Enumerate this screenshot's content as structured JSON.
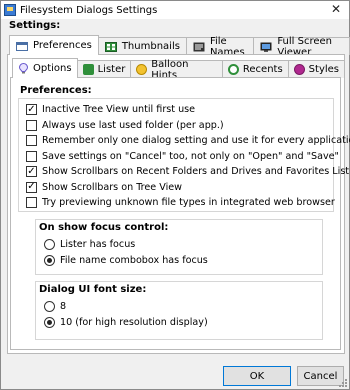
{
  "window": {
    "title": "Filesystem Dialogs Settings",
    "close_glyph": "✕"
  },
  "settings_label": "Settings:",
  "outer_tabs": [
    {
      "label": "Preferences",
      "icon": "preferences-icon"
    },
    {
      "label": "Thumbnails",
      "icon": "thumbnails-icon"
    },
    {
      "label": "File Names",
      "icon": "file-names-icon"
    },
    {
      "label": "Full Screen Viewer",
      "icon": "full-screen-viewer-icon"
    }
  ],
  "inner_tabs": [
    {
      "label": "Options",
      "icon": "options-icon"
    },
    {
      "label": "Lister",
      "icon": "lister-icon"
    },
    {
      "label": "Balloon Hints",
      "icon": "balloon-hints-icon"
    },
    {
      "label": "Recents",
      "icon": "recents-icon"
    },
    {
      "label": "Styles",
      "icon": "styles-icon"
    }
  ],
  "preferences": {
    "title": "Preferences:",
    "items": [
      {
        "label": "Inactive Tree View until first use",
        "checked": true
      },
      {
        "label": "Always use last used folder (per app.)",
        "checked": false
      },
      {
        "label": "Remember only one dialog setting and use it for every application",
        "checked": false
      },
      {
        "label": "Save settings on \"Cancel\" too, not only on \"Open\" and \"Save\"",
        "checked": false
      },
      {
        "label": "Show Scrollbars on Recent Folders and Drives and Favorites List",
        "checked": true
      },
      {
        "label": "Show Scrollbars on Tree View",
        "checked": true
      },
      {
        "label": "Try previewing unknown file types in integrated web browser",
        "checked": false
      }
    ]
  },
  "focus_control": {
    "title": "On show focus control:",
    "options": [
      {
        "label": "Lister has focus",
        "selected": false
      },
      {
        "label": "File name combobox has focus",
        "selected": true
      }
    ]
  },
  "font_size": {
    "title": "Dialog UI font size:",
    "options": [
      {
        "label": "8",
        "selected": false
      },
      {
        "label": "10 (for high resolution display)",
        "selected": true
      }
    ]
  },
  "buttons": {
    "ok": "OK",
    "cancel": "Cancel"
  },
  "colors": {
    "accent": "#0078d7",
    "check": "#000000"
  }
}
